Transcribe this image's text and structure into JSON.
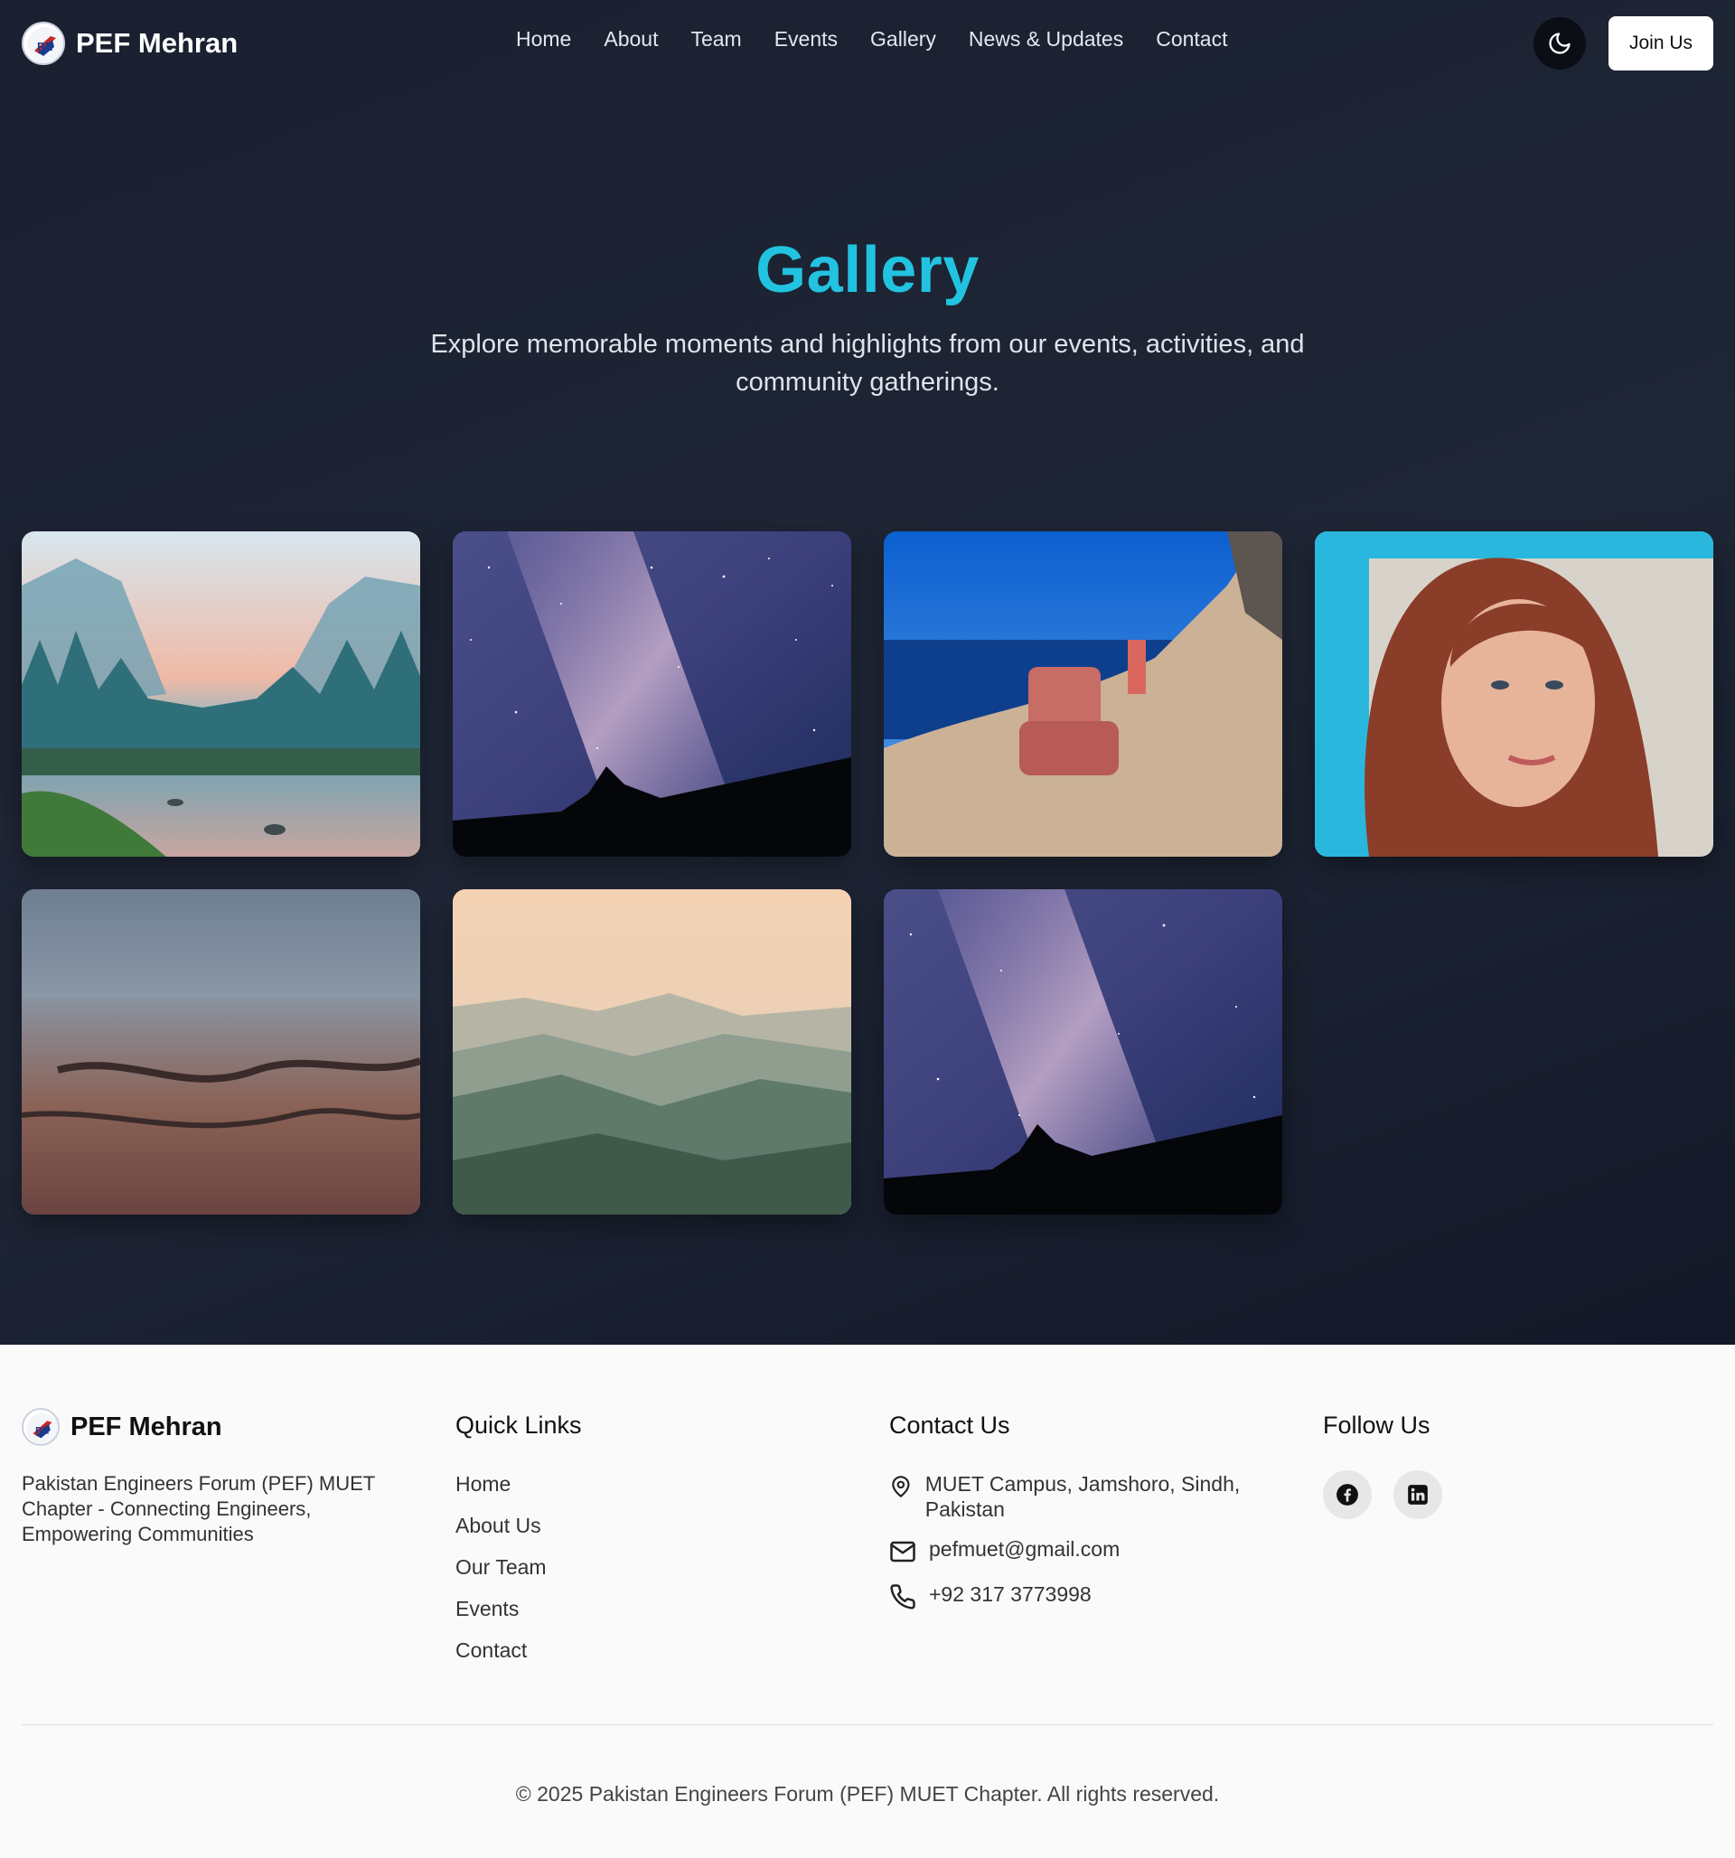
{
  "header": {
    "brand": "PEF Mehran",
    "nav": [
      "Home",
      "About",
      "Team",
      "Events",
      "Gallery",
      "News & Updates",
      "Contact"
    ],
    "join_label": "Join Us",
    "theme_icon": "moon-icon"
  },
  "hero": {
    "title": "Gallery",
    "subtitle": "Explore memorable moments and highlights from our events, activities, and community gatherings."
  },
  "gallery": {
    "images": [
      "valley-landscape",
      "milky-way-night-sky",
      "armchair-on-sea-cliff",
      "portrait-woman",
      "canyon-overlook",
      "misty-mountain-ridges",
      "milky-way-night-sky"
    ]
  },
  "footer": {
    "brand": "PEF Mehran",
    "description": "Pakistan Engineers Forum (PEF) MUET Chapter - Connecting Engineers, Empowering Communities",
    "quick_links_title": "Quick Links",
    "quick_links": [
      "Home",
      "About Us",
      "Our Team",
      "Events",
      "Contact"
    ],
    "contact_title": "Contact Us",
    "contact": {
      "address": "MUET Campus, Jamshoro, Sindh, Pakistan",
      "email": "pefmuet@gmail.com",
      "phone": "+92 317 3773998"
    },
    "follow_title": "Follow Us",
    "social": [
      "facebook-icon",
      "linkedin-icon"
    ],
    "copyright": "© 2025 Pakistan Engineers Forum (PEF) MUET Chapter. All rights reserved."
  },
  "colors": {
    "accent": "#22c3e0",
    "dark_bg": "#1d2333",
    "footer_bg": "#fafafa"
  }
}
